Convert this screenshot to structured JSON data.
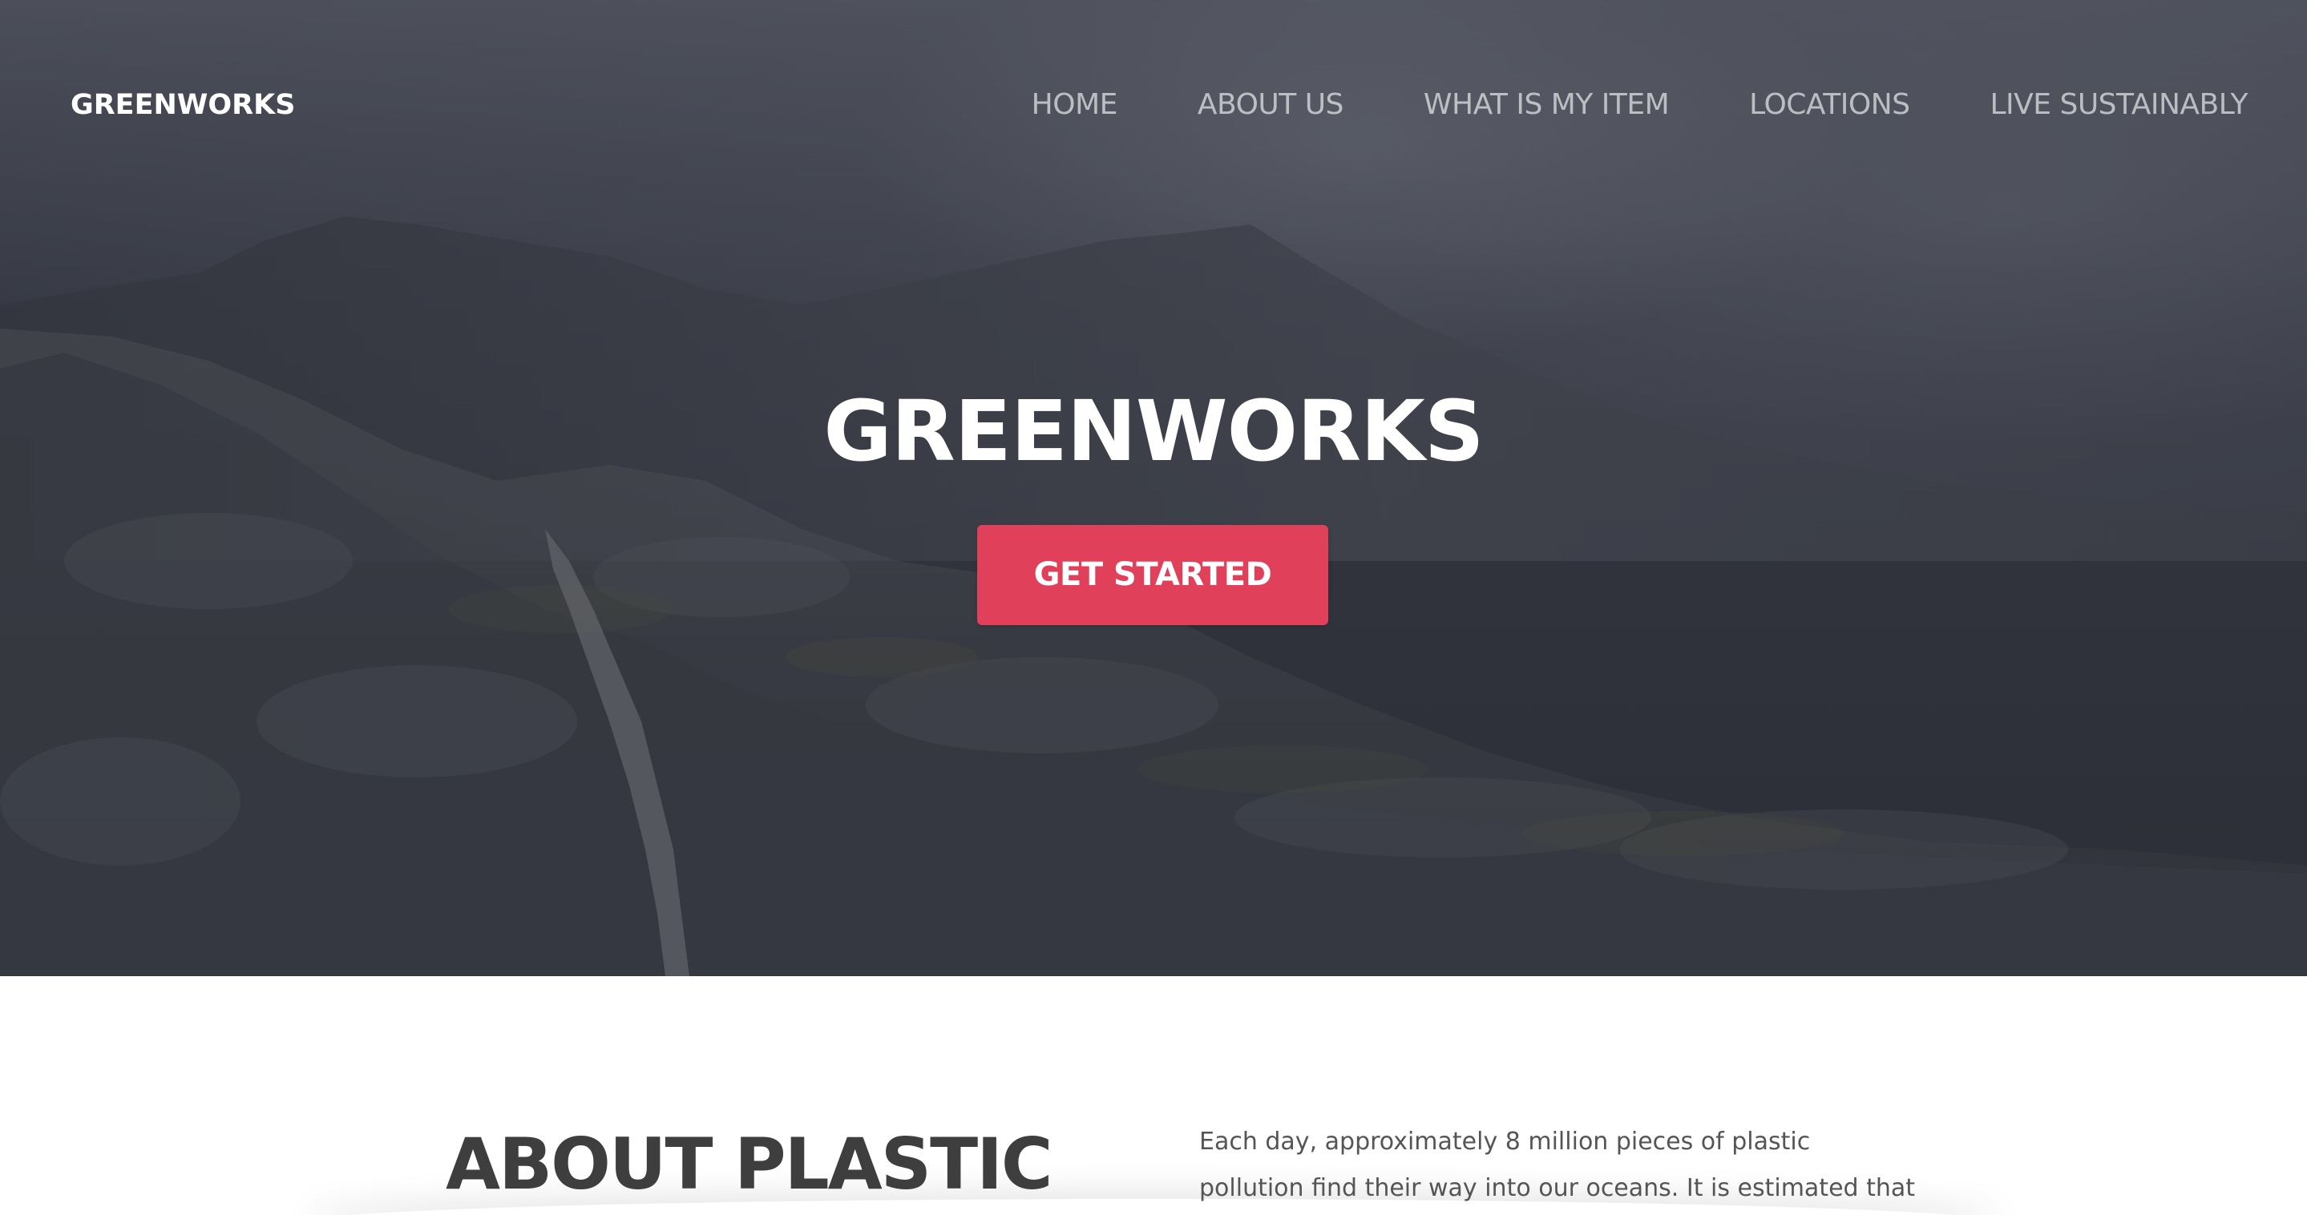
{
  "header": {
    "brand": "GREENWORKS",
    "nav": [
      {
        "label": "HOME"
      },
      {
        "label": "ABOUT US"
      },
      {
        "label": "WHAT IS MY ITEM"
      },
      {
        "label": "LOCATIONS"
      },
      {
        "label": "LIVE SUSTAINABLY"
      }
    ]
  },
  "hero": {
    "title": "GREENWORKS",
    "cta_label": "GET STARTED",
    "cta_color": "#e0405a"
  },
  "about": {
    "title": "ABOUT PLASTIC",
    "text_lines": [
      "Each day, approximately 8 million pieces of plastic",
      "pollution find their way into our oceans. It is estimated that"
    ]
  }
}
